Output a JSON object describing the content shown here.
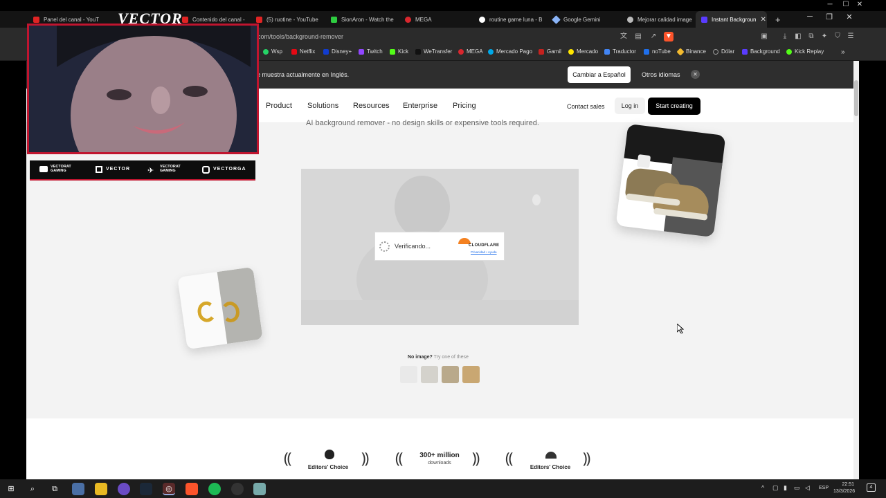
{
  "browser": {
    "tabs": [
      {
        "title": "Panel del canal - YouT",
        "color": "#e02424"
      },
      {
        "title": "Contenido del canal -",
        "color": "#e02424"
      },
      {
        "title": "(5) ruotine - YouTube",
        "color": "#e02424"
      },
      {
        "title": "SionAron - Watch the",
        "color": "#2ecc40"
      },
      {
        "title": "MEGA",
        "color": "#d9272e"
      },
      {
        "title": "routine game luna - B",
        "color": "#4285f4"
      },
      {
        "title": "Google Gemini",
        "color": "#8ab4f8"
      },
      {
        "title": "Mejorar calidad image",
        "color": "#bbbbbb"
      },
      {
        "title": "Instant Backgroun",
        "color": "#5a3cff"
      }
    ],
    "url": "com/tools/background-remover",
    "bookmarks": [
      "Wsp",
      "Netflix",
      "Disney+",
      "Twitch",
      "Kick",
      "WeTransfer",
      "MEGA",
      "Mercado Pago",
      "Gamil",
      "Mercado",
      "Traductor",
      "noTube",
      "Binance",
      "Dólar",
      "Background",
      "Kick Replay"
    ],
    "bookmark_colors": [
      "#25d366",
      "#e50914",
      "#113ccf",
      "#9146ff",
      "#53fc18",
      "#222",
      "#d9272e",
      "#00a8e8",
      "#c5221f",
      "#ffe600",
      "#4285f4",
      "#1f6feb",
      "#f3ba2f",
      "#888",
      "#5a3cff",
      "#53fc18"
    ]
  },
  "overlay": {
    "logo": "VECTOR",
    "socials": [
      "VECTORAT GAMING",
      "VECTOR",
      "VECTORAT GAMING",
      "VECTORGA"
    ]
  },
  "translate_bar": {
    "message": "e muestra actualmente en Inglés.",
    "switch_button": "Cambiar a Español",
    "other_languages": "Otros idiomas"
  },
  "nav": {
    "items": [
      "Product",
      "Solutions",
      "Resources",
      "Enterprise",
      "Pricing"
    ],
    "contact": "Contact sales",
    "login": "Log in",
    "cta": "Start creating"
  },
  "hero": {
    "subtitle": "AI background remover - no design skills or expensive tools required.",
    "verifying": "Verificando...",
    "cf_brand": "CLOUDFLARE",
    "cf_links": "Privacidad • Ayuda",
    "no_image": "No image?",
    "try_these": "Try one of these"
  },
  "awards": {
    "left_label": "Editors' Choice",
    "center_big": "300+ million",
    "center_small": "downloads",
    "right_label": "Editors' Choice"
  },
  "taskbar": {
    "lang": "ESP",
    "time": "22:51",
    "date": "13/3/2026",
    "notif_count": "4"
  }
}
